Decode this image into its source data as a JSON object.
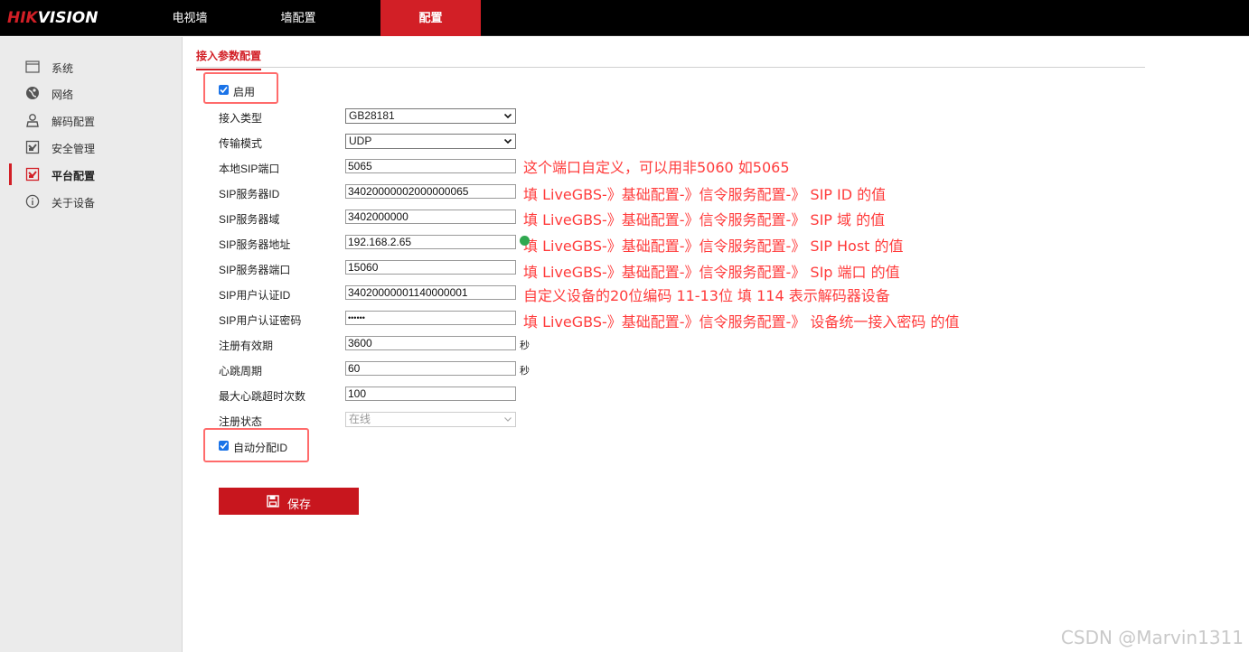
{
  "header": {
    "logo_hik": "HIK",
    "logo_vision": "VISION",
    "tabs": [
      {
        "label": "电视墙"
      },
      {
        "label": "墙配置"
      },
      {
        "label": "配置"
      }
    ]
  },
  "sidebar": {
    "items": [
      {
        "label": "系统",
        "icon": "system-icon"
      },
      {
        "label": "网络",
        "icon": "network-icon"
      },
      {
        "label": "解码配置",
        "icon": "decode-config-icon"
      },
      {
        "label": "安全管理",
        "icon": "security-icon"
      },
      {
        "label": "平台配置",
        "icon": "platform-icon"
      },
      {
        "label": "关于设备",
        "icon": "info-icon"
      }
    ]
  },
  "main": {
    "subtab": "接入参数配置",
    "enable_label": "启用",
    "fields": {
      "access_type_label": "接入类型",
      "access_type_value": "GB28181",
      "transport_label": "传输模式",
      "transport_value": "UDP",
      "local_sip_port_label": "本地SIP端口",
      "local_sip_port_value": "5065",
      "sip_server_id_label": "SIP服务器ID",
      "sip_server_id_value": "34020000002000000065",
      "sip_server_domain_label": "SIP服务器域",
      "sip_server_domain_value": "3402000000",
      "sip_server_addr_label": "SIP服务器地址",
      "sip_server_addr_value": "192.168.2.65",
      "sip_server_port_label": "SIP服务器端口",
      "sip_server_port_value": "15060",
      "sip_user_id_label": "SIP用户认证ID",
      "sip_user_id_value": "34020000001140000001",
      "sip_password_label": "SIP用户认证密码",
      "sip_password_value": "••••••",
      "reg_valid_label": "注册有效期",
      "reg_valid_value": "3600",
      "reg_valid_unit": "秒",
      "heartbeat_label": "心跳周期",
      "heartbeat_value": "60",
      "heartbeat_unit": "秒",
      "max_timeout_label": "最大心跳超时次数",
      "max_timeout_value": "100",
      "reg_status_label": "注册状态",
      "reg_status_value": "在线"
    },
    "auto_id_label": "自动分配ID",
    "save_label": "保存"
  },
  "annotations": {
    "local_port": "这个端口自定义，可以用非5060 如5065",
    "server_id": "填 LiveGBS-》基础配置-》信令服务配置-》  SIP ID 的值",
    "server_domain": "填 LiveGBS-》基础配置-》信令服务配置-》  SIP 域 的值",
    "server_addr": "填 LiveGBS-》基础配置-》信令服务配置-》  SIP Host 的值",
    "server_port": "填 LiveGBS-》基础配置-》信令服务配置-》 SIp 端口 的值",
    "user_id": "自定义设备的20位编码 11-13位 填 114 表示解码器设备",
    "password": "填 LiveGBS-》基础配置-》信令服务配置-》  设备统一接入密码 的值"
  },
  "watermark": "CSDN @Marvin1311",
  "colors": {
    "brand_red": "#d21f26",
    "annotation_red": "#ff3b3b",
    "checkbox_blue": "#1a73e8"
  }
}
